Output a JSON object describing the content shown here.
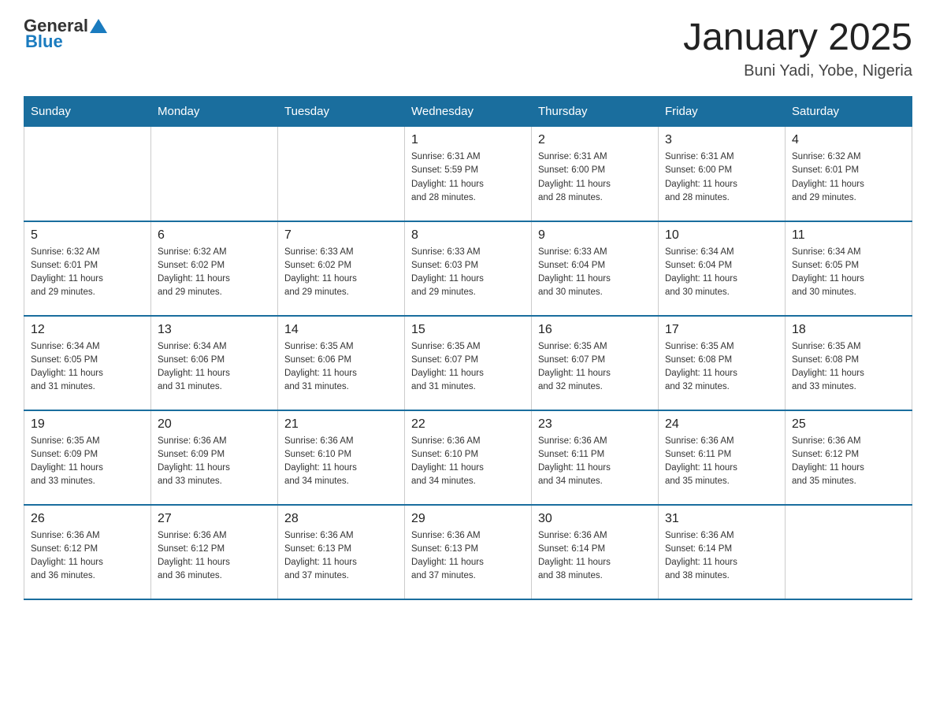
{
  "header": {
    "logo_general": "General",
    "logo_blue": "Blue",
    "title": "January 2025",
    "subtitle": "Buni Yadi, Yobe, Nigeria"
  },
  "weekdays": [
    "Sunday",
    "Monday",
    "Tuesday",
    "Wednesday",
    "Thursday",
    "Friday",
    "Saturday"
  ],
  "weeks": [
    [
      {
        "day": "",
        "info": ""
      },
      {
        "day": "",
        "info": ""
      },
      {
        "day": "",
        "info": ""
      },
      {
        "day": "1",
        "info": "Sunrise: 6:31 AM\nSunset: 5:59 PM\nDaylight: 11 hours\nand 28 minutes."
      },
      {
        "day": "2",
        "info": "Sunrise: 6:31 AM\nSunset: 6:00 PM\nDaylight: 11 hours\nand 28 minutes."
      },
      {
        "day": "3",
        "info": "Sunrise: 6:31 AM\nSunset: 6:00 PM\nDaylight: 11 hours\nand 28 minutes."
      },
      {
        "day": "4",
        "info": "Sunrise: 6:32 AM\nSunset: 6:01 PM\nDaylight: 11 hours\nand 29 minutes."
      }
    ],
    [
      {
        "day": "5",
        "info": "Sunrise: 6:32 AM\nSunset: 6:01 PM\nDaylight: 11 hours\nand 29 minutes."
      },
      {
        "day": "6",
        "info": "Sunrise: 6:32 AM\nSunset: 6:02 PM\nDaylight: 11 hours\nand 29 minutes."
      },
      {
        "day": "7",
        "info": "Sunrise: 6:33 AM\nSunset: 6:02 PM\nDaylight: 11 hours\nand 29 minutes."
      },
      {
        "day": "8",
        "info": "Sunrise: 6:33 AM\nSunset: 6:03 PM\nDaylight: 11 hours\nand 29 minutes."
      },
      {
        "day": "9",
        "info": "Sunrise: 6:33 AM\nSunset: 6:04 PM\nDaylight: 11 hours\nand 30 minutes."
      },
      {
        "day": "10",
        "info": "Sunrise: 6:34 AM\nSunset: 6:04 PM\nDaylight: 11 hours\nand 30 minutes."
      },
      {
        "day": "11",
        "info": "Sunrise: 6:34 AM\nSunset: 6:05 PM\nDaylight: 11 hours\nand 30 minutes."
      }
    ],
    [
      {
        "day": "12",
        "info": "Sunrise: 6:34 AM\nSunset: 6:05 PM\nDaylight: 11 hours\nand 31 minutes."
      },
      {
        "day": "13",
        "info": "Sunrise: 6:34 AM\nSunset: 6:06 PM\nDaylight: 11 hours\nand 31 minutes."
      },
      {
        "day": "14",
        "info": "Sunrise: 6:35 AM\nSunset: 6:06 PM\nDaylight: 11 hours\nand 31 minutes."
      },
      {
        "day": "15",
        "info": "Sunrise: 6:35 AM\nSunset: 6:07 PM\nDaylight: 11 hours\nand 31 minutes."
      },
      {
        "day": "16",
        "info": "Sunrise: 6:35 AM\nSunset: 6:07 PM\nDaylight: 11 hours\nand 32 minutes."
      },
      {
        "day": "17",
        "info": "Sunrise: 6:35 AM\nSunset: 6:08 PM\nDaylight: 11 hours\nand 32 minutes."
      },
      {
        "day": "18",
        "info": "Sunrise: 6:35 AM\nSunset: 6:08 PM\nDaylight: 11 hours\nand 33 minutes."
      }
    ],
    [
      {
        "day": "19",
        "info": "Sunrise: 6:35 AM\nSunset: 6:09 PM\nDaylight: 11 hours\nand 33 minutes."
      },
      {
        "day": "20",
        "info": "Sunrise: 6:36 AM\nSunset: 6:09 PM\nDaylight: 11 hours\nand 33 minutes."
      },
      {
        "day": "21",
        "info": "Sunrise: 6:36 AM\nSunset: 6:10 PM\nDaylight: 11 hours\nand 34 minutes."
      },
      {
        "day": "22",
        "info": "Sunrise: 6:36 AM\nSunset: 6:10 PM\nDaylight: 11 hours\nand 34 minutes."
      },
      {
        "day": "23",
        "info": "Sunrise: 6:36 AM\nSunset: 6:11 PM\nDaylight: 11 hours\nand 34 minutes."
      },
      {
        "day": "24",
        "info": "Sunrise: 6:36 AM\nSunset: 6:11 PM\nDaylight: 11 hours\nand 35 minutes."
      },
      {
        "day": "25",
        "info": "Sunrise: 6:36 AM\nSunset: 6:12 PM\nDaylight: 11 hours\nand 35 minutes."
      }
    ],
    [
      {
        "day": "26",
        "info": "Sunrise: 6:36 AM\nSunset: 6:12 PM\nDaylight: 11 hours\nand 36 minutes."
      },
      {
        "day": "27",
        "info": "Sunrise: 6:36 AM\nSunset: 6:12 PM\nDaylight: 11 hours\nand 36 minutes."
      },
      {
        "day": "28",
        "info": "Sunrise: 6:36 AM\nSunset: 6:13 PM\nDaylight: 11 hours\nand 37 minutes."
      },
      {
        "day": "29",
        "info": "Sunrise: 6:36 AM\nSunset: 6:13 PM\nDaylight: 11 hours\nand 37 minutes."
      },
      {
        "day": "30",
        "info": "Sunrise: 6:36 AM\nSunset: 6:14 PM\nDaylight: 11 hours\nand 38 minutes."
      },
      {
        "day": "31",
        "info": "Sunrise: 6:36 AM\nSunset: 6:14 PM\nDaylight: 11 hours\nand 38 minutes."
      },
      {
        "day": "",
        "info": ""
      }
    ]
  ]
}
